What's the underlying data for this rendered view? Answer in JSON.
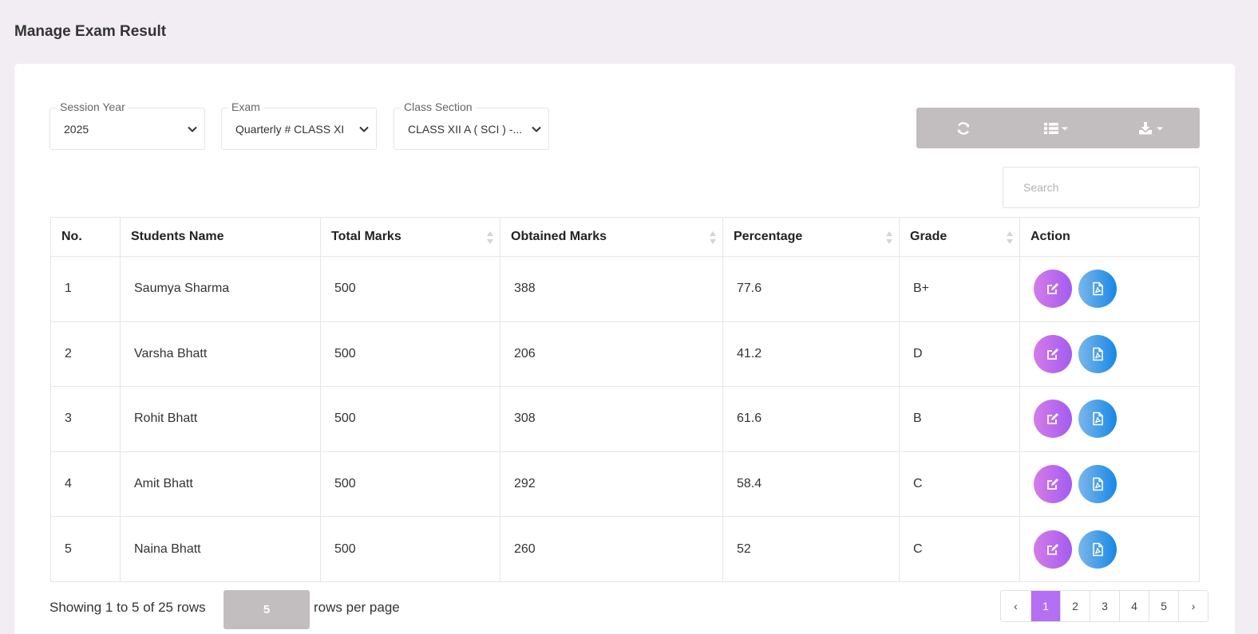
{
  "page": {
    "title": "Manage Exam Result"
  },
  "filters": {
    "session_year": {
      "label": "Session Year",
      "value": "2025"
    },
    "exam": {
      "label": "Exam",
      "value": "Quarterly # CLASS XI"
    },
    "class_section": {
      "label": "Class Section",
      "value": "CLASS XII A ( SCI ) -..."
    }
  },
  "toolbar": {
    "icons": [
      "refresh-icon",
      "columns-icon",
      "export-icon"
    ]
  },
  "search": {
    "placeholder": "Search",
    "value": ""
  },
  "table": {
    "columns": [
      "No.",
      "Students Name",
      "Total Marks",
      "Obtained Marks",
      "Percentage",
      "Grade",
      "Action"
    ],
    "rows": [
      {
        "no": "1",
        "name": "Saumya Sharma",
        "total": "500",
        "obtained": "388",
        "percentage": "77.6",
        "grade": "B+"
      },
      {
        "no": "2",
        "name": "Varsha Bhatt",
        "total": "500",
        "obtained": "206",
        "percentage": "41.2",
        "grade": "D"
      },
      {
        "no": "3",
        "name": "Rohit Bhatt",
        "total": "500",
        "obtained": "308",
        "percentage": "61.6",
        "grade": "B"
      },
      {
        "no": "4",
        "name": "Amit Bhatt",
        "total": "500",
        "obtained": "292",
        "percentage": "58.4",
        "grade": "C"
      },
      {
        "no": "5",
        "name": "Naina Bhatt",
        "total": "500",
        "obtained": "260",
        "percentage": "52",
        "grade": "C"
      }
    ],
    "action_icons": [
      "edit-icon",
      "pdf-icon"
    ]
  },
  "footer": {
    "showing": "Showing 1 to 5 of 25 rows",
    "per_page_value": "5",
    "per_page_label": "rows per page"
  },
  "pagination": {
    "prev": "‹",
    "pages": [
      "1",
      "2",
      "3",
      "4",
      "5"
    ],
    "active": "1",
    "next": "›"
  },
  "colors": {
    "background": "#f1edf2",
    "toolbar": "#c2bdbe",
    "active_page": "#b56ff2",
    "edit_gradient": [
      "#d57be8",
      "#a25cf0"
    ],
    "pdf_gradient": [
      "#7bb6ea",
      "#1888e6"
    ]
  }
}
